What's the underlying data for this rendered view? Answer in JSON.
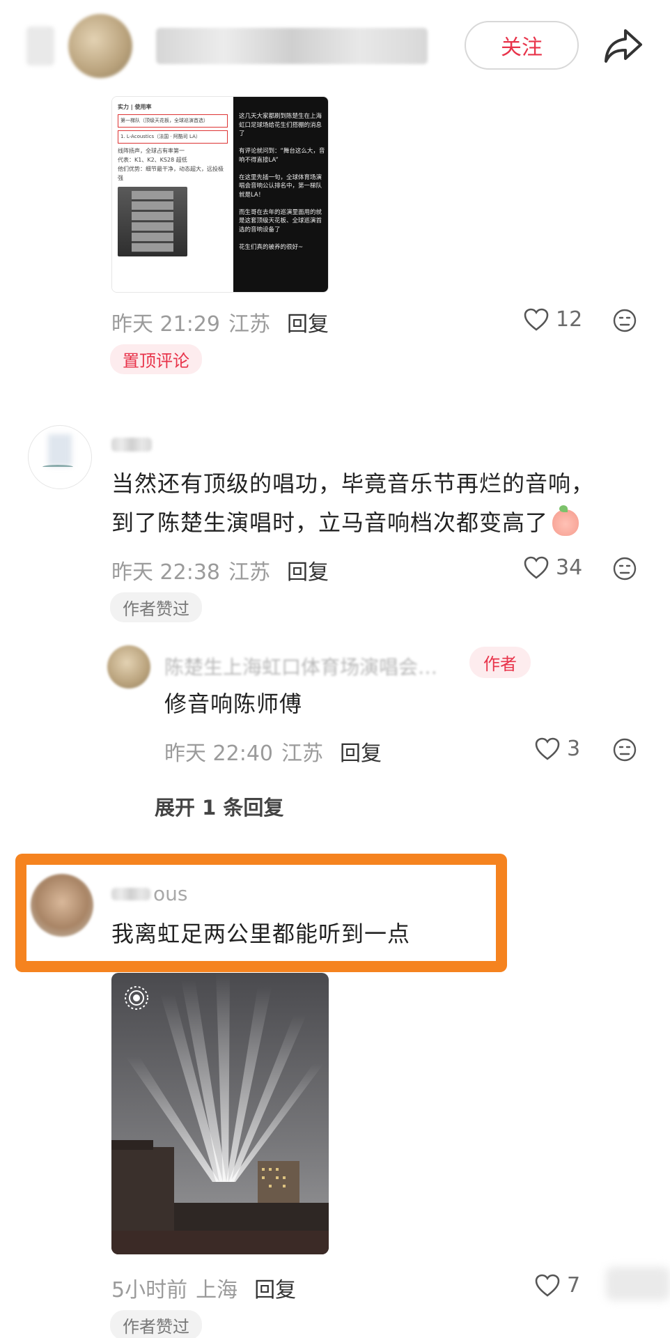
{
  "header": {
    "follow_label": "关注",
    "share_icon": "share-arrow-icon"
  },
  "comments": [
    {
      "image": {
        "heading": "实力 | 使用率",
        "rank_label": "第一梯队（顶级天花板，全球巡演首选）",
        "brand": "1. L-Acoustics（法国 · 阿酷司 LA）",
        "bullets": [
          "线阵扬声，全球占有率第一",
          "代表：K1、K2、KS28 超低",
          "他们优势：细节最干净，动态超大，远投极强"
        ],
        "overlay_text": "这几天大家都刷到陈楚生在上海虹口足球场给花生们搭棚的消息了\n\n有评论就问到：“舞台这么大，音响不得直接LA”\n\n在这里先插一句，全球体育场演唱会音响公认排名中，第一梯队就是LA！\n\n而生哥在去年的巡演里面用的就是这套顶级天花板、全球巡演首选的音响设备了\n\n花生们真的被养的很好~"
      },
      "time": "昨天 21:29",
      "location": "江苏",
      "reply_label": "回复",
      "likes": "12",
      "pinned_label": "置顶评论"
    },
    {
      "text_line1": "当然还有顶级的唱功，毕竟音乐节再烂的音响，",
      "text_line2": "到了陈楚生演唱时，立马音响档次都变高了",
      "emoji": "peach-emoji-icon",
      "time": "昨天 22:38",
      "location": "江苏",
      "reply_label": "回复",
      "likes": "34",
      "badge": "作者赞过",
      "sub_reply": {
        "name_partial": "陈楚生上海虹口体育场演唱会…",
        "author_label": "作者",
        "text": "修音响陈师傅",
        "time": "昨天 22:40",
        "location": "江苏",
        "reply_label": "回复",
        "likes": "3"
      },
      "expand_label": "展开 1 条回复"
    },
    {
      "name_partial": "ous",
      "text": "我离虹足两公里都能听到一点",
      "time": "5小时前",
      "location": "上海",
      "reply_label": "回复",
      "likes": "7",
      "badge": "作者赞过"
    }
  ],
  "colors": {
    "accent_red": "#e8334a",
    "highlight_orange": "#f5831f",
    "meta_gray": "#9b9b9b"
  }
}
